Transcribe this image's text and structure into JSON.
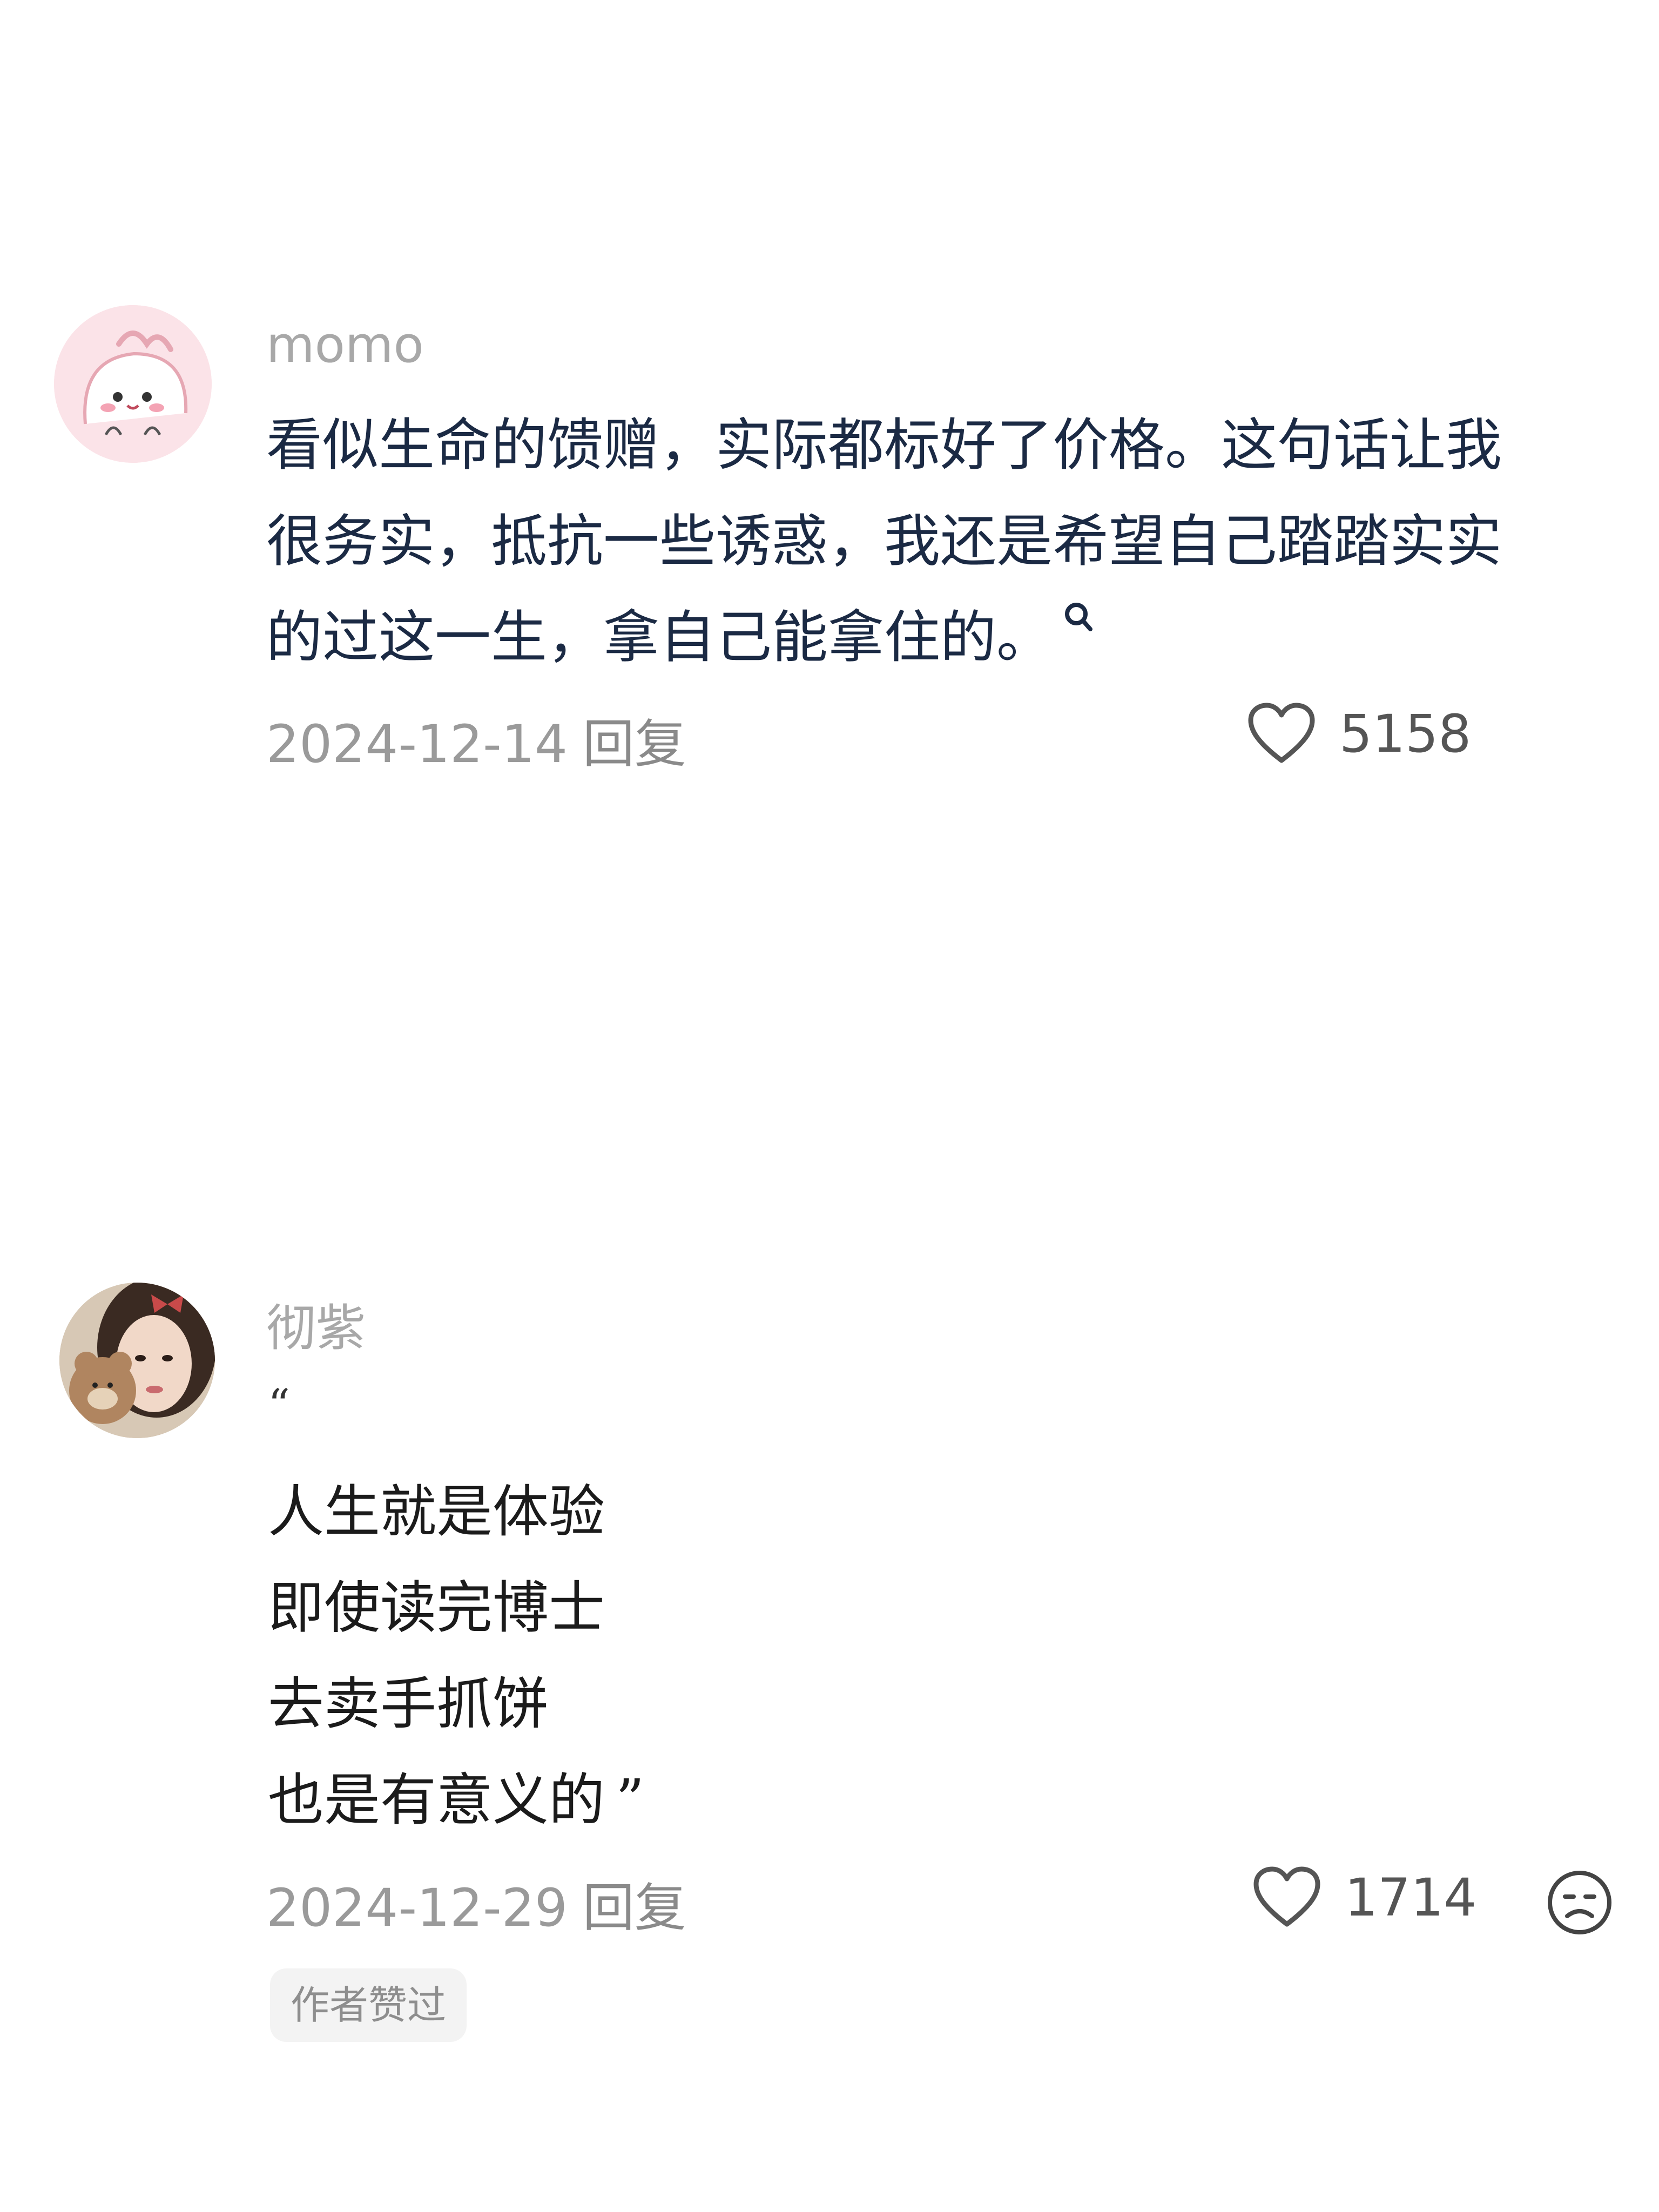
{
  "comments": [
    {
      "username": "momo",
      "lines": [
        "看似生命的馈赠，实际都标好了价格。这句话让我",
        "很务实，抵抗一些诱惑，我还是希望自己踏踏实实",
        "的过这一生，拿自己能拿住的。"
      ],
      "date": "2024-12-14",
      "reply_label": "回复",
      "likes": "5158"
    },
    {
      "username": "彻紫",
      "quote_open": "“",
      "lines": [
        "人生就是体验",
        "即使读完博士",
        "去卖手抓饼",
        "也是有意义的"
      ],
      "quote_close": "”",
      "date": "2024-12-29",
      "reply_label": "回复",
      "likes": "1714",
      "badge": "作者赞过"
    }
  ],
  "colors": {
    "username": "#a8a8a8",
    "body_text": "#1b2a44",
    "meta": "#9a9a9a",
    "badge_bg": "#f3f3f3"
  },
  "icons": [
    "heart-outline-icon",
    "search-icon",
    "dislike-face-icon"
  ]
}
